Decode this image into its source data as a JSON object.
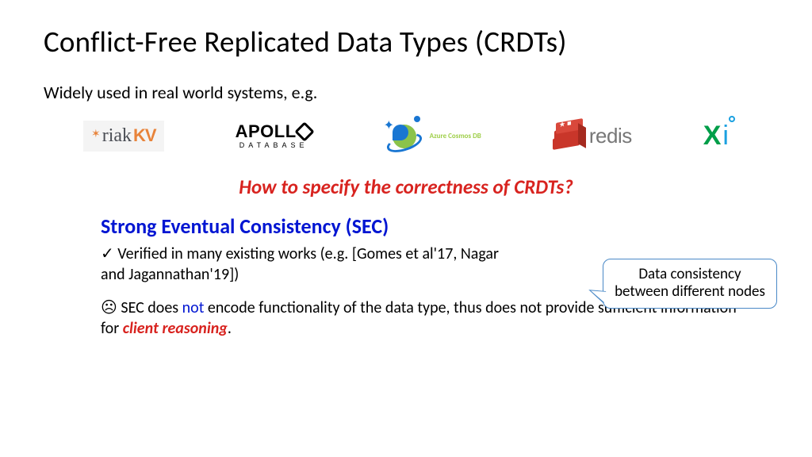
{
  "title": "Conflict-Free Replicated Data Types (CRDTs)",
  "subtitle": "Widely used in real world systems, e.g.",
  "logos": {
    "riak": {
      "main": "riak",
      "suffix": "KV"
    },
    "apollo": {
      "main_left": "APOLL",
      "sub": "DATABASE"
    },
    "cosmos": {
      "label": "Azure Cosmos DB"
    },
    "redis": {
      "label": "redis"
    },
    "xi": {
      "x": "X",
      "i": "i"
    }
  },
  "question": "How to specify the correctness of CRDTs?",
  "sec_heading": "Strong Eventual Consistency (SEC)",
  "callout": "Data consistency between different nodes",
  "bullet1": {
    "icon": "✓",
    "text": " Verified in many existing works (e.g. [Gomes et al'17, Nagar and Jagannathan'19])"
  },
  "bullet2": {
    "icon": "☹",
    "pre": " SEC does ",
    "not": "not",
    "mid": " encode functionality of the data type, thus does not provide sufficient information for ",
    "client": "client reasoning",
    "post": "."
  }
}
